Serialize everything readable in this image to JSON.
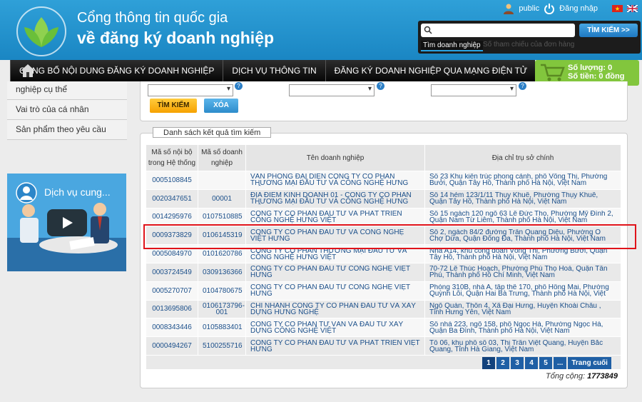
{
  "header": {
    "title_line1": "Cổng thông tin quốc gia",
    "title_line2": "về đăng ký doanh nghiệp",
    "user": "public",
    "login": "Đăng nhập"
  },
  "search": {
    "button": "TÌM KIẾM >>",
    "tab_active": "Tìm doanh nghiệp",
    "tab_inactive": "Số tham chiếu của đơn hàng"
  },
  "nav": {
    "items": [
      "CÔNG BỐ NỘI DUNG ĐĂNG KÝ DOANH NGHIỆP",
      "DỊCH VỤ THÔNG TIN",
      "ĐĂNG KÝ DOANH NGHIỆP QUA MẠNG ĐIỆN TỬ"
    ]
  },
  "cart": {
    "count": "Số lượng: 0",
    "amount": "Số tiền: 0 đồng"
  },
  "sidebar": {
    "items": [
      "nghiệp cụ thể",
      "Vai trò của cá nhân",
      "Sản phẩm theo yêu cầu"
    ],
    "video_title": "Dịch vụ cung..."
  },
  "filters": {
    "find_button": "TÌM KIẾM",
    "clear_button": "XÓA"
  },
  "results": {
    "legend": "Danh sách kết quả tìm kiếm",
    "headers": [
      "Mã số nội bộ trong Hệ thống",
      "Mã số doanh nghiệp",
      "Tên doanh nghiệp",
      "Địa chỉ trụ sở chính"
    ],
    "rows": [
      [
        "0005108845",
        "",
        "VĂN PHÒNG ĐẠI DIỆN CÔNG TY CỔ PHẦN THƯƠNG MẠI ĐẦU TƯ VÀ CÔNG NGHỆ HƯNG VIỆT",
        "Số 23 Khu kiến trúc phong cảnh, phố Võng Thị, Phường Bưởi, Quận Tây Hồ, Thành phố Hà Nội, Việt Nam"
      ],
      [
        "0020347651",
        "00001",
        "ĐỊA ĐIỂM KINH DOANH 01 - CÔNG TY CỔ PHẦN THƯƠNG MẠI ĐẦU TƯ VÀ CÔNG NGHỆ HƯNG VIỆT",
        "Số 14 hẻm 123/1/11 Thụy Khuê, Phường Thụy Khuê, Quận Tây Hồ, Thành phố Hà Nội, Việt Nam"
      ],
      [
        "0014295976",
        "0107510885",
        "CÔNG TY CỔ PHẦN ĐẦU TƯ VÀ PHÁT TRIỂN CÔNG NGHỆ HƯNG VIỆT",
        "Số 15 ngách 120 ngõ 63 Lê Đức Thọ, Phường Mỹ Đình 2, Quận Nam Từ Liêm, Thành phố Hà Nội, Việt Nam"
      ],
      [
        "0009373829",
        "0106145319",
        "CÔNG TY CỔ PHẦN ĐẦU TƯ VÀ CÔNG NGHỆ VIỆT HƯNG",
        "Số 2, ngách 84/2 đường Trần Quang Diệu, Phường Ô Chợ Dừa, Quận Đống Đa, Thành phố Hà Nội, Việt Nam"
      ],
      [
        "0005084970",
        "0101620786",
        "CÔNG TY CỔ PHẦN THƯƠNG MẠI ĐẦU TƯ VÀ CÔNG NGHỆ HƯNG VIỆT",
        "Nhà A14, khu công đoàn Võng Thị, Phường Bưởi, Quận Tây Hồ, Thành phố Hà Nội, Việt Nam"
      ],
      [
        "0003724549",
        "0309136366",
        "CÔNG TY CỔ PHẦN ĐẦU TƯ CÔNG NGHỆ VIỆT HƯNG",
        "70-72 Lê Thúc Hoạch, Phường Phú Thọ Hoà, Quận Tân Phú, Thành phố Hồ Chí Minh, Việt Nam"
      ],
      [
        "0005270707",
        "0104780675",
        "CÔNG TY CỔ PHẦN ĐẦU TƯ CÔNG NGHỆ VIỆT HƯNG",
        "Phòng 310B, nhà A, tập thể 170, phố Hồng Mai, Phường Quỳnh Lôi, Quận Hai Bà Trưng, Thành phố Hà Nội, Việt Nam"
      ],
      [
        "0013695806",
        "0106173796-001",
        "CHI NHÁNH CÔNG TY CỔ PHẦN ĐẦU TƯ VÀ XÂY DỰNG HƯNG NGHỆ",
        "Ngõ Quán, Thôn 4, Xã Đại Hưng, Huyện Khoái Châu , Tỉnh Hưng Yên, Việt Nam"
      ],
      [
        "0008343446",
        "0105883401",
        "CÔNG TY CỔ PHẦN TƯ VẤN VÀ ĐẦU TƯ XÂY DỰNG CÔNG NGHỆ VIỆT",
        "Số nhà 223, ngõ 158, phố Ngọc Hà, Phường Ngọc Hà, Quận Ba Đình, Thành phố Hà Nội, Việt Nam"
      ],
      [
        "0000494267",
        "5100255716",
        "CÔNG TY CỔ PHẦN ĐẦU TƯ VÀ PHÁT TRIỂN VIỆT HƯNG",
        "Tổ 06, khu phố số 03, Thị Trấn Việt Quang, Huyện Bắc Quang, Tỉnh Hà Giang, Việt Nam"
      ]
    ]
  },
  "pager": {
    "pages": [
      "1",
      "2",
      "3",
      "4",
      "5",
      "..."
    ],
    "last": "Trang cuối"
  },
  "total": {
    "label": "Tổng cộng:",
    "value": "1773849"
  },
  "colors": {
    "header_blue": "#1a86c3",
    "cart_green": "#82c63d",
    "highlight_red": "#e0131a",
    "link_blue": "#1b4f8a"
  }
}
